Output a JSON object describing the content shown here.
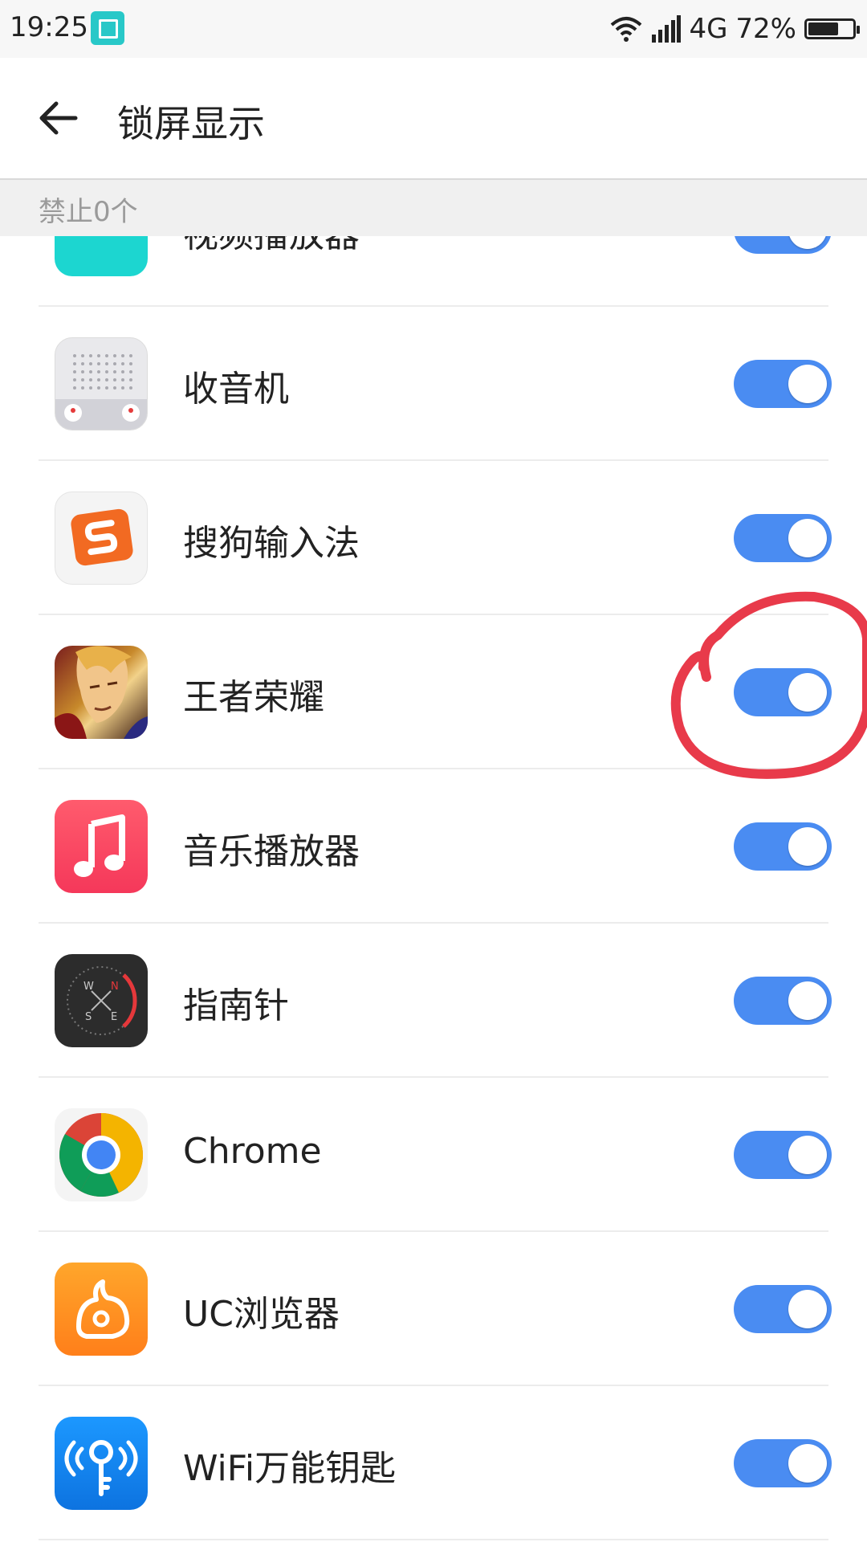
{
  "status_bar": {
    "time": "19:25",
    "network": "4G",
    "battery_percent": "72%",
    "battery_level": 0.72,
    "icons": [
      "screenshot-icon",
      "wifi-icon",
      "signal-icon",
      "battery-icon"
    ]
  },
  "header": {
    "title": "锁屏显示",
    "back_icon": "back-arrow-icon"
  },
  "section": {
    "label": "禁止0个"
  },
  "apps": [
    {
      "name": "视频播放器",
      "icon": "video-player-icon",
      "enabled": true
    },
    {
      "name": "收音机",
      "icon": "radio-icon",
      "enabled": true
    },
    {
      "name": "搜狗输入法",
      "icon": "sogou-icon",
      "enabled": true
    },
    {
      "name": "王者荣耀",
      "icon": "honor-of-kings-icon",
      "enabled": true
    },
    {
      "name": "音乐播放器",
      "icon": "music-icon",
      "enabled": true
    },
    {
      "name": "指南针",
      "icon": "compass-icon",
      "enabled": true
    },
    {
      "name": "Chrome",
      "icon": "chrome-icon",
      "enabled": true
    },
    {
      "name": "UC浏览器",
      "icon": "uc-browser-icon",
      "enabled": true
    },
    {
      "name": "WiFi万能钥匙",
      "icon": "wifi-key-icon",
      "enabled": true
    }
  ],
  "colors": {
    "toggle_on": "#4a8cf2",
    "annotation": "#e83a4a"
  }
}
